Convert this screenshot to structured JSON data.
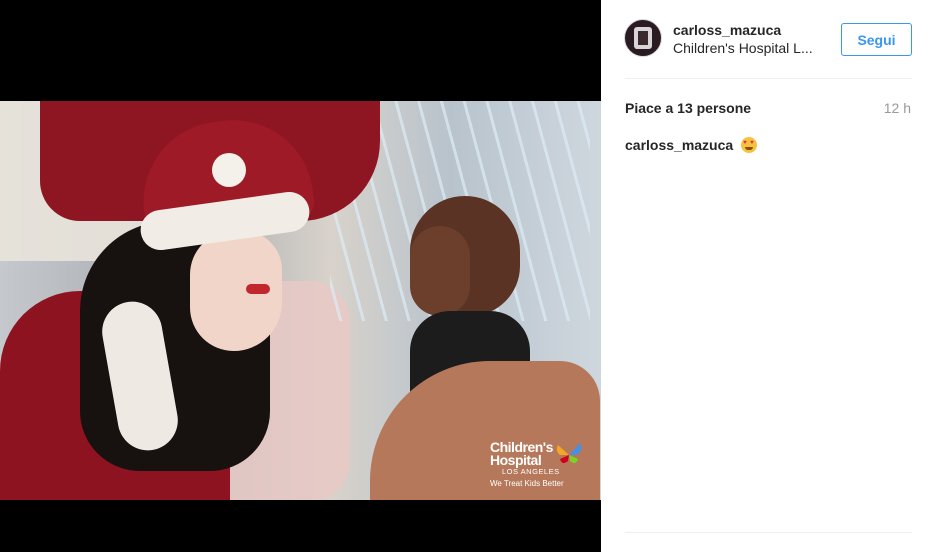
{
  "post": {
    "username": "carloss_mazuca",
    "location": "Children's Hospital L...",
    "follow_label": "Segui",
    "likes": "Piace a 13 persone",
    "time": "12 h",
    "caption_user": "carloss_mazuca",
    "caption_emoji": "heart-eyes-emoji"
  },
  "photo": {
    "logo_line1": "Children's",
    "logo_line2": "Hospital",
    "logo_line3": "LOS ANGELES",
    "logo_tagline": "We Treat Kids Better"
  },
  "colors": {
    "accent": "#3897f0",
    "text": "#262626",
    "muted": "#999999",
    "divider": "#efefef"
  }
}
